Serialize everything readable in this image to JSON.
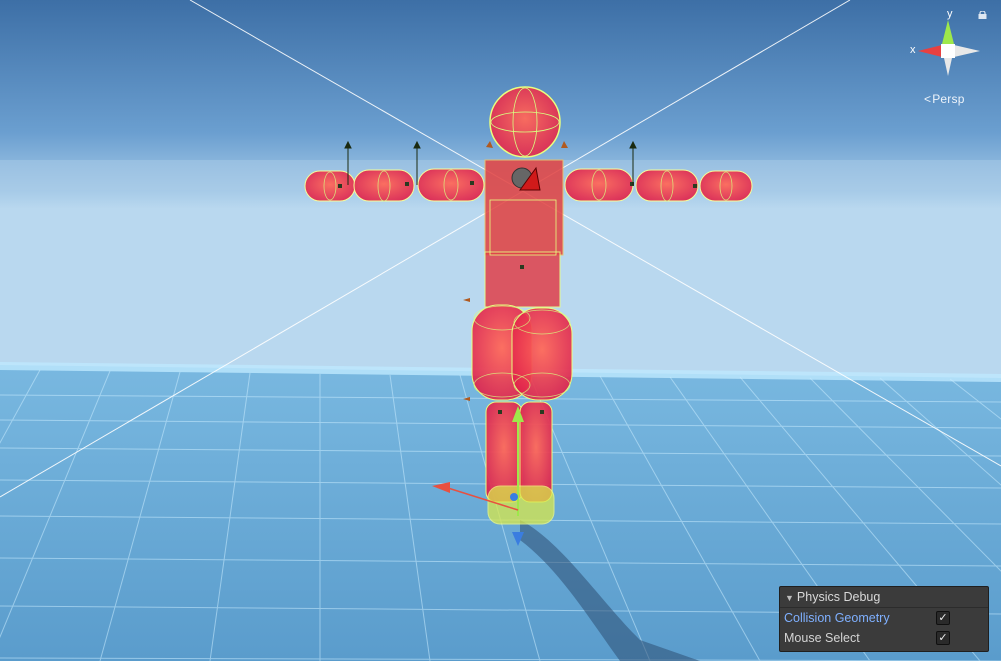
{
  "viewport": {
    "projection_label": "Persp",
    "axis_y_label": "y",
    "axis_x_label": "x",
    "sky_color": "#5a8dc4",
    "ground_color": "#6fa9d4",
    "collider_color": "#ff3a2a",
    "wire_color": "#c8f060"
  },
  "physics_debug": {
    "title": "Physics Debug",
    "options": [
      {
        "label": "Collision Geometry",
        "checked": true,
        "check_glyph": "✓"
      },
      {
        "label": "Mouse Select",
        "checked": true,
        "check_glyph": "✓"
      }
    ]
  }
}
